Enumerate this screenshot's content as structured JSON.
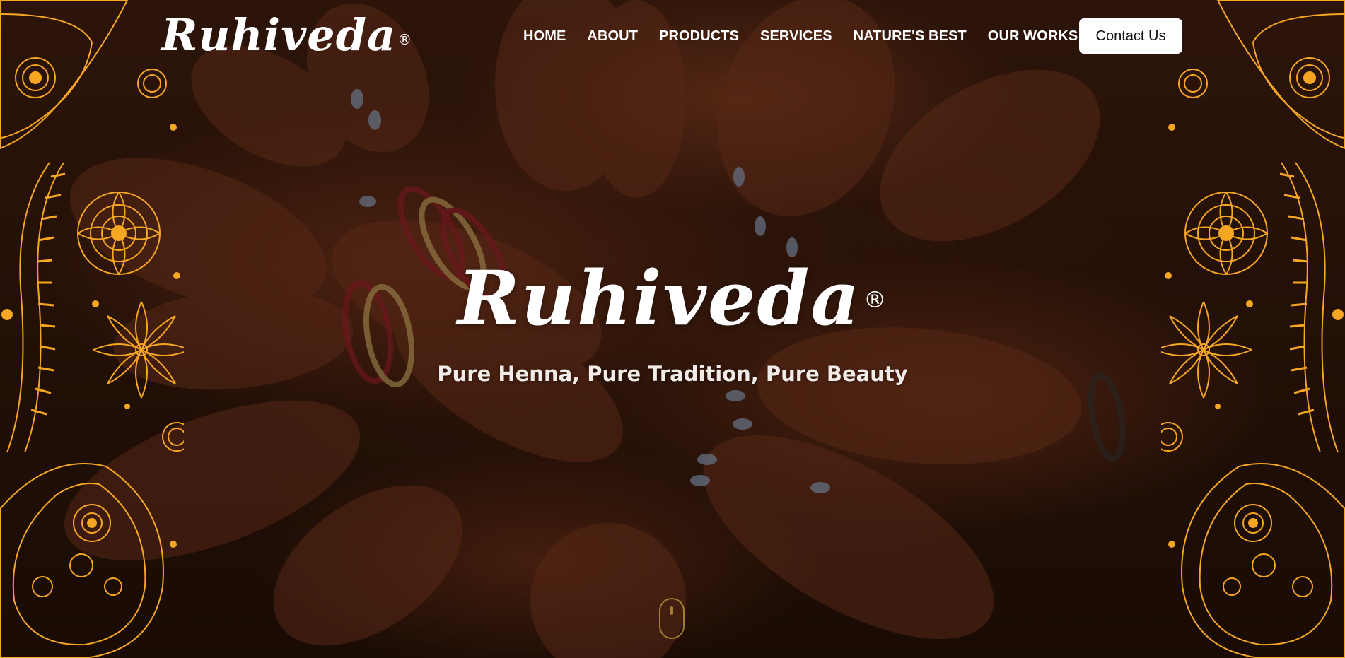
{
  "brand": {
    "name": "Ruhiveda",
    "registered": "®"
  },
  "nav": {
    "items": [
      {
        "label": "HOME"
      },
      {
        "label": "ABOUT"
      },
      {
        "label": "PRODUCTS"
      },
      {
        "label": "SERVICES"
      },
      {
        "label": "NATURE'S BEST"
      },
      {
        "label": "OUR WORKS"
      }
    ],
    "contact_label": "Contact Us"
  },
  "hero": {
    "title": "Ruhiveda",
    "registered": "®",
    "tagline": "Pure Henna, Pure Tradition, Pure Beauty"
  },
  "colors": {
    "ornament_gold": "#f5a623",
    "overlay": "#1a0d07",
    "text": "#ffffff"
  },
  "icons": {
    "scroll": "mouse-scroll-icon",
    "ornaments": "paisley-mandala-ornament"
  }
}
